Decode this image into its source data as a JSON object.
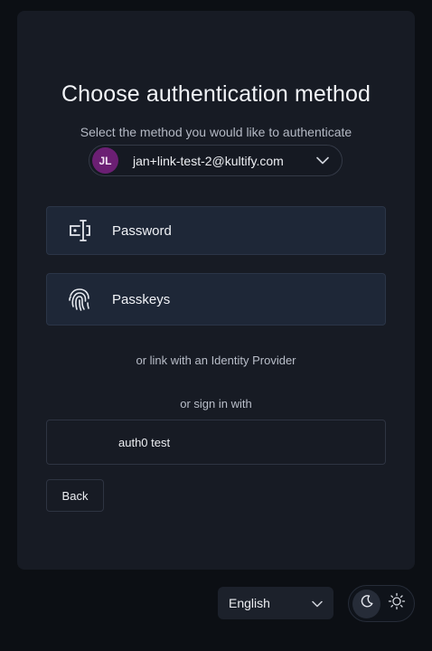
{
  "login": {
    "title": "Choose authentication method",
    "subtitle": "Select the method you would like to authenticate",
    "account": {
      "initials": "JL",
      "email": "jan+link-test-2@kultify.com",
      "avatar_color": "#6b1f73"
    },
    "methods": [
      {
        "label": "Password",
        "icon": "password-icon"
      },
      {
        "label": "Passkeys",
        "icon": "fingerprint-icon"
      }
    ],
    "idp_text": "or link with an Identity Provider",
    "signin_with_text": "or sign in with",
    "providers": [
      {
        "label": "auth0 test"
      }
    ],
    "back_label": "Back"
  },
  "footer": {
    "language": "English",
    "theme": {
      "active": "dark",
      "options": [
        "moon-icon",
        "sun-icon"
      ]
    }
  }
}
